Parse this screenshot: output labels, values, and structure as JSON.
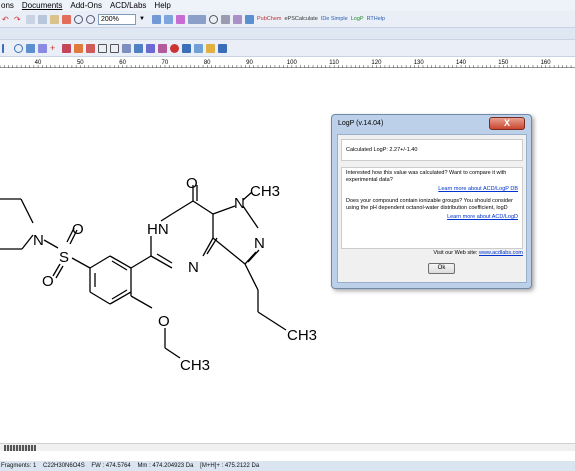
{
  "menu": {
    "items": [
      "ons",
      "Documents",
      "Add-Ons",
      "ACD/Labs",
      "Help"
    ]
  },
  "toolbar": {
    "zoom_value": "200%",
    "buttons": [
      "PubChem",
      "ePSCalculate",
      "IDe Simple",
      "LogP",
      "RTHelp"
    ]
  },
  "ruler": {
    "ticks": [
      "40",
      "50",
      "60",
      "70",
      "80",
      "90",
      "100",
      "110",
      "120",
      "130",
      "140",
      "150",
      "160"
    ]
  },
  "structure": {
    "atoms": [
      "O",
      "N",
      "CH3",
      "HN",
      "N",
      "N",
      "N",
      "S",
      "O",
      "O",
      "O",
      "CH3",
      "CH3"
    ]
  },
  "dialog": {
    "title": "LogP  (v.14.04)",
    "close_label": "X",
    "calculated": "Calculated LogP:  2.27+/-1.40",
    "q1": "Interested how this value was calculated? Want to compare it with experimental data?",
    "link1": "Learn more about ACD/LogP DB",
    "q2": "Does your compound contain ionizable groups? You should consider using the pH dependent octanol-water distribution coefficient, logD",
    "link2": "Learn more about ACD/LogD",
    "visit_label": "Visit our Web site:",
    "website": "www.acdlabs.com",
    "ok_label": "Ok"
  },
  "status": {
    "fragments": "Fragments: 1",
    "formula": "C22H30N6O4S",
    "fw": "FW : 474.5764",
    "mass": "Mm : 474.204923 Da",
    "mh": "[M+H]+ : 475.2122 Da"
  },
  "colors": {
    "menubar_bg": "#eef2f9",
    "dialog_frame": "#bcd0ea",
    "link": "#0033cc",
    "close": "#c9452f"
  }
}
